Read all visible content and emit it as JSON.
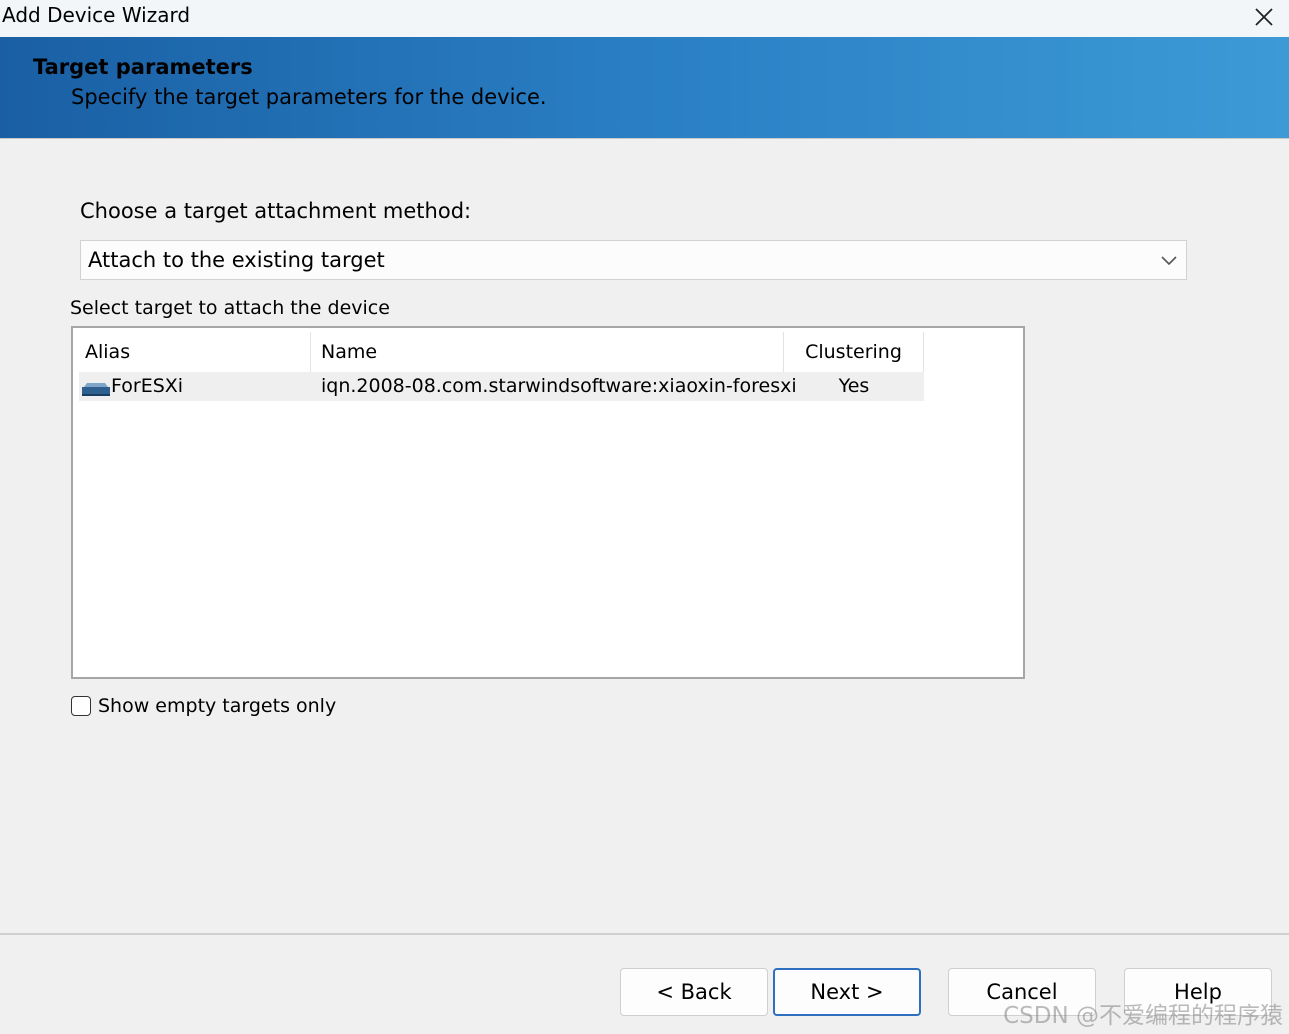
{
  "window": {
    "title": "Add Device Wizard"
  },
  "header": {
    "title": "Target parameters",
    "subtitle": "Specify the target parameters for the device."
  },
  "method": {
    "label": "Choose a target attachment method:",
    "selected": "Attach to the existing target"
  },
  "targets": {
    "label": "Select target to attach the device",
    "columns": [
      "Alias",
      "Name",
      "Clustering"
    ],
    "rows": [
      {
        "alias": "ForESXi",
        "name": "iqn.2008-08.com.starwindsoftware:xiaoxin-foresxi",
        "clustering": "Yes",
        "icon": "target-icon"
      }
    ]
  },
  "options": {
    "show_empty_label": "Show empty targets only",
    "show_empty_checked": false
  },
  "buttons": {
    "back": "< Back",
    "next": "Next >",
    "cancel": "Cancel",
    "help": "Help"
  },
  "watermark": "CSDN @不爱编程的程序猿",
  "colors": {
    "header_start": "#1a5fa4",
    "header_end": "#3d9ad6",
    "primary_border": "#2f6fbf"
  }
}
